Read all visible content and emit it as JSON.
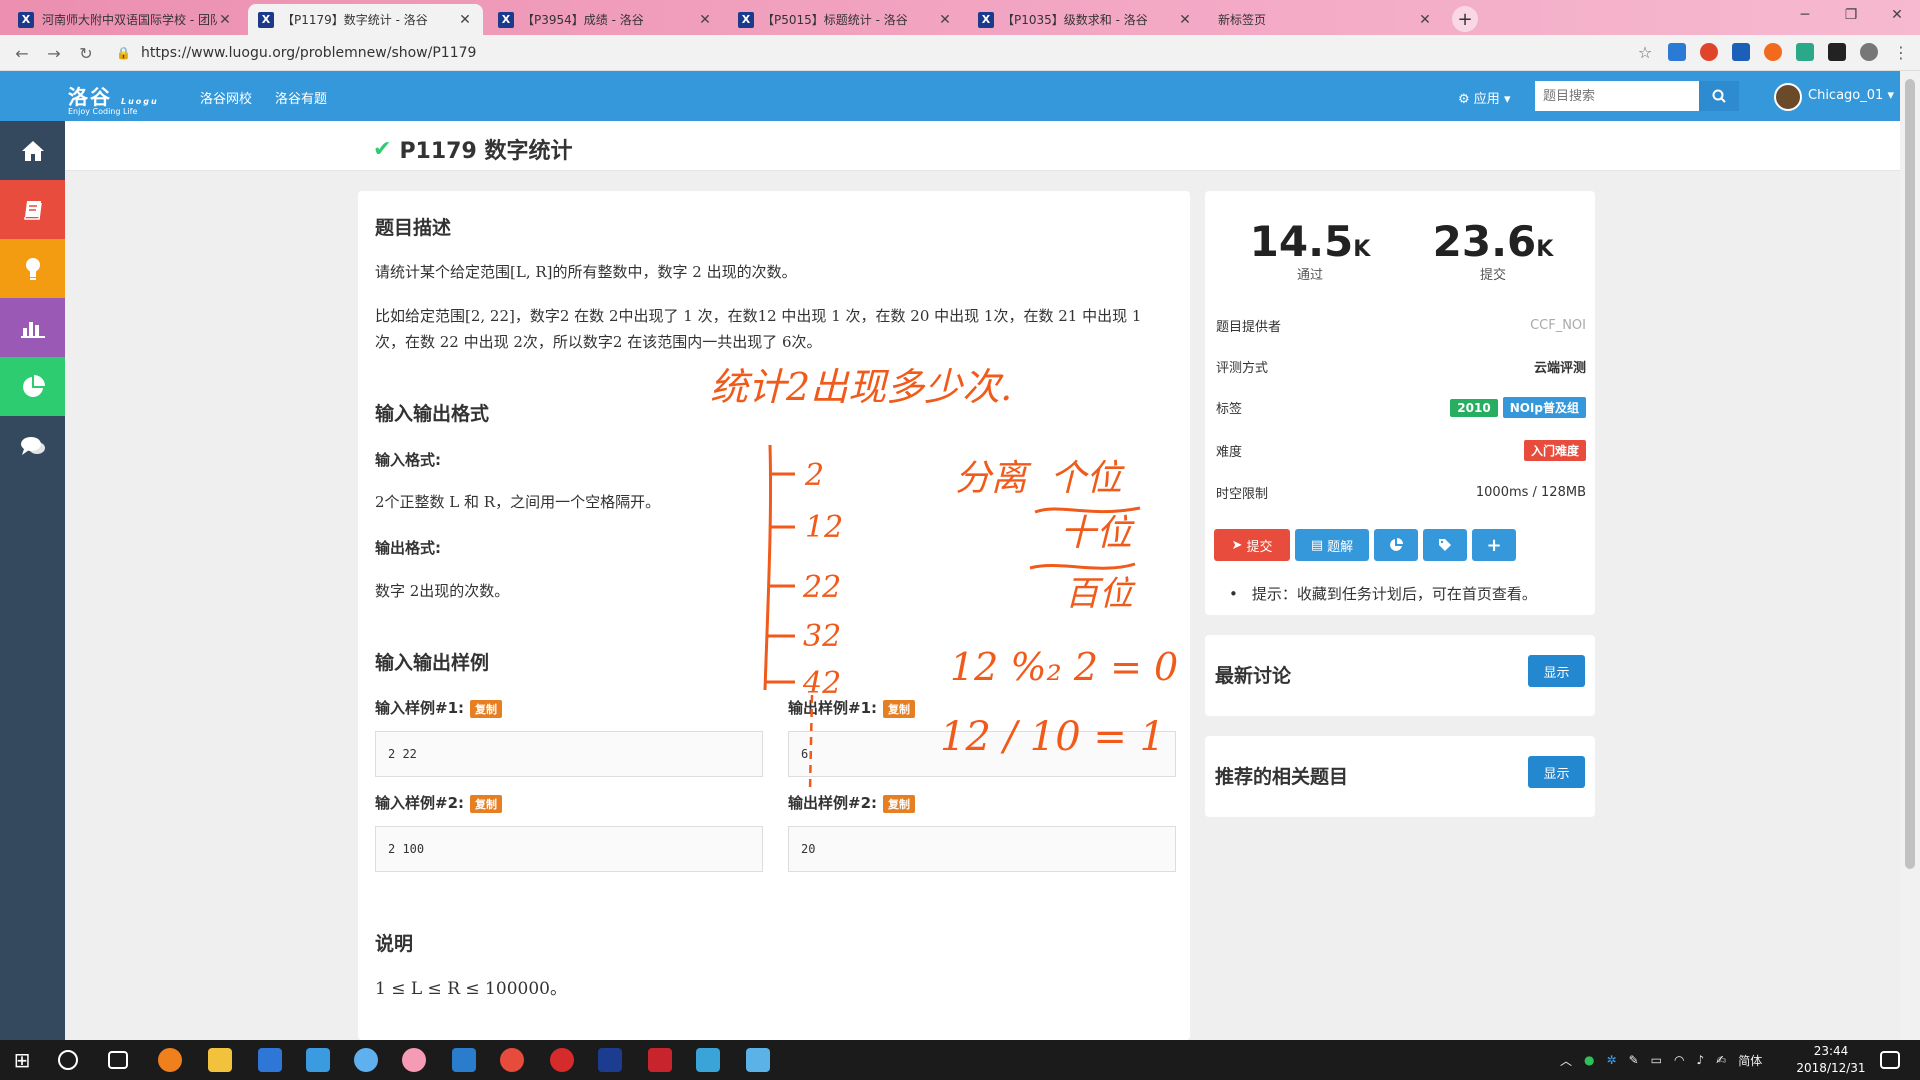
{
  "browser": {
    "tabs": [
      {
        "title": "河南师大附中双语国际学校 - 团队",
        "active": false
      },
      {
        "title": "【P1179】数字统计 - 洛谷",
        "active": true
      },
      {
        "title": "【P3954】成绩 - 洛谷",
        "active": false
      },
      {
        "title": "【P5015】标题统计 - 洛谷",
        "active": false
      },
      {
        "title": "【P1035】级数求和 - 洛谷",
        "active": false
      },
      {
        "title": "新标签页",
        "active": false
      }
    ],
    "tab_icon_letter": "X",
    "url": "https://www.luogu.org/problemnew/show/P1179"
  },
  "header": {
    "logo": "洛谷",
    "logo_sub": "Enjoy Coding Life",
    "logo_luogu": "Luogu",
    "nav": [
      "洛谷网校",
      "洛谷有题"
    ],
    "apps_label": "应用",
    "search_placeholder": "题目搜索",
    "username": "Chicago_01"
  },
  "sidebar": [
    "home-icon",
    "book-icon",
    "lightbulb-icon",
    "chart-icon",
    "pie-icon",
    "comments-icon"
  ],
  "problem": {
    "title": "P1179 数字统计",
    "desc_heading": "题目描述",
    "desc_1": "请统计某个给定范围[L, R]的所有整数中，数字 2 出现的次数。",
    "desc_2a": "比如给定范围[2, 22]，数字2 在数 2中出现了 1 次，在数12 中出现 1 次，在数 20 中出现 1次，在数 21 中出现 1",
    "desc_2b": "次，在数 22 中出现 2次，所以数字2 在该范围内一共出现了 6次。",
    "io_heading": "输入输出格式",
    "input_label": "输入格式:",
    "input_text": "2个正整数 L 和 R，之间用一个空格隔开。",
    "output_label": "输出格式:",
    "output_text": "数字 2出现的次数。",
    "samples_heading": "输入输出样例",
    "copy_label": "复制",
    "samples": [
      {
        "in_label": "输入样例#1:",
        "in": "2 22",
        "out_label": "输出样例#1:",
        "out": "6"
      },
      {
        "in_label": "输入样例#2:",
        "in": "2 100",
        "out_label": "输出样例#2:",
        "out": "20"
      }
    ],
    "note_heading": "说明",
    "note_text": "1 ≤ L ≤ R ≤ 100000。"
  },
  "stats": {
    "passed": "14.5",
    "passed_unit": "K",
    "passed_label": "通过",
    "submitted": "23.6",
    "submitted_unit": "K",
    "submitted_label": "提交"
  },
  "info": {
    "provider_label": "题目提供者",
    "provider": "CCF_NOI",
    "judge_label": "评测方式",
    "judge": "云端评测",
    "tags_label": "标签",
    "tags": [
      "2010",
      "NOIp普及组"
    ],
    "difficulty_label": "难度",
    "difficulty": "入门难度",
    "limit_label": "时空限制",
    "limit": "1000ms / 128MB"
  },
  "actions": {
    "submit": "提交",
    "solution": "题解"
  },
  "hint": "提示：收藏到任务计划后，可在首页查看。",
  "discussion": {
    "title": "最新讨论",
    "button": "显示"
  },
  "related": {
    "title": "推荐的相关题目",
    "button": "显示"
  },
  "annotations": {
    "title": "统计2出现多少次.",
    "list": [
      "2",
      "12",
      "22",
      "32",
      "42"
    ],
    "split": "分离",
    "ones": "个位",
    "tens": "十位",
    "hundreds": "百位",
    "mod": "12 %₂ 2 = 0",
    "div": "12 / 10 = 1"
  },
  "taskbar": {
    "lang": "简体",
    "time": "23:44",
    "date": "2018/12/31"
  },
  "colors": {
    "header_blue": "#3498db",
    "sidebar": "#34495e",
    "tag_year": "#27ae60",
    "tag_group": "#3498db",
    "difficulty": "#e74c3c",
    "ink": "#f05a1a"
  }
}
